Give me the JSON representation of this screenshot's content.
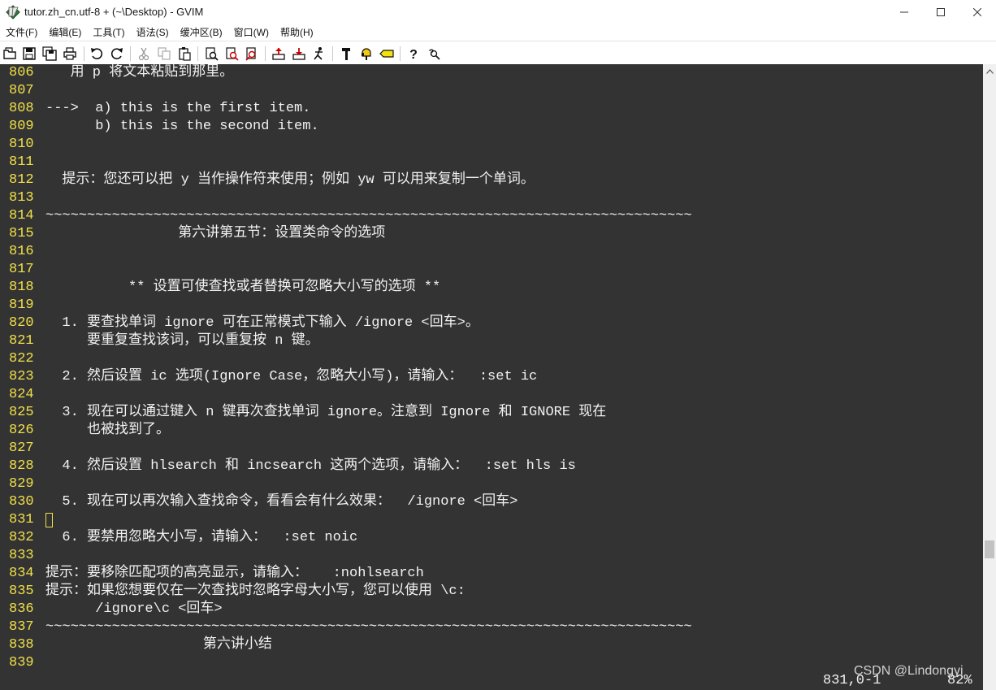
{
  "window": {
    "title": "tutor.zh_cn.utf-8 + (~\\Desktop) - GVIM",
    "icon": "gvim-app-icon",
    "controls": [
      "minimize-icon",
      "maximize-icon",
      "close-icon"
    ]
  },
  "menu": [
    "文件(F)",
    "编辑(E)",
    "工具(T)",
    "语法(S)",
    "缓冲区(B)",
    "窗口(W)",
    "帮助(H)"
  ],
  "toolbar": {
    "buttons": [
      "open-icon",
      "save-icon",
      "save-all-icon",
      "print-icon",
      "undo-icon",
      "redo-icon",
      "cut-icon",
      "copy-icon",
      "paste-icon",
      "find-replace-icon",
      "find-next-icon",
      "find-prev-icon",
      "load-session-icon",
      "save-session-icon",
      "run-script-icon",
      "make-icon",
      "build-tags-icon",
      "jump-tag-icon",
      "help-icon",
      "find-help-icon"
    ]
  },
  "editor": {
    "lines": [
      {
        "num": "806",
        "text": "   用 p 将文本粘贴到那里。"
      },
      {
        "num": "807",
        "text": ""
      },
      {
        "num": "808",
        "text": "--->  a) this is the first item."
      },
      {
        "num": "809",
        "text": "      b) this is the second item."
      },
      {
        "num": "810",
        "text": ""
      },
      {
        "num": "811",
        "text": ""
      },
      {
        "num": "812",
        "text": "  提示：您还可以把 y 当作操作符来使用；例如 yw 可以用来复制一个单词。"
      },
      {
        "num": "813",
        "text": ""
      },
      {
        "num": "814",
        "text": "~~~~~~~~~~~~~~~~~~~~~~~~~~~~~~~~~~~~~~~~~~~~~~~~~~~~~~~~~~~~~~~~~~~~~~~~~~~~~~"
      },
      {
        "num": "815",
        "text": "                第六讲第五节：设置类命令的选项"
      },
      {
        "num": "816",
        "text": ""
      },
      {
        "num": "817",
        "text": ""
      },
      {
        "num": "818",
        "text": "          ** 设置可使查找或者替换可忽略大小写的选项 **"
      },
      {
        "num": "819",
        "text": ""
      },
      {
        "num": "820",
        "text": "  1. 要查找单词 ignore 可在正常模式下输入 /ignore <回车>。"
      },
      {
        "num": "821",
        "text": "     要重复查找该词，可以重复按 n 键。"
      },
      {
        "num": "822",
        "text": ""
      },
      {
        "num": "823",
        "text": "  2. 然后设置 ic 选项(Ignore Case，忽略大小写)，请输入：  :set ic"
      },
      {
        "num": "824",
        "text": ""
      },
      {
        "num": "825",
        "text": "  3. 现在可以通过键入 n 键再次查找单词 ignore。注意到 Ignore 和 IGNORE 现在"
      },
      {
        "num": "826",
        "text": "     也被找到了。"
      },
      {
        "num": "827",
        "text": ""
      },
      {
        "num": "828",
        "text": "  4. 然后设置 hlsearch 和 incsearch 这两个选项，请输入：  :set hls is"
      },
      {
        "num": "829",
        "text": ""
      },
      {
        "num": "830",
        "text": "  5. 现在可以再次输入查找命令，看看会有什么效果：  /ignore <回车>"
      },
      {
        "num": "831",
        "text": ""
      },
      {
        "num": "832",
        "text": "  6. 要禁用忽略大小写，请输入：  :set noic"
      },
      {
        "num": "833",
        "text": ""
      },
      {
        "num": "834",
        "text": "提示：要移除匹配项的高亮显示，请输入：   :nohlsearch"
      },
      {
        "num": "835",
        "text": "提示：如果您想要仅在一次查找时忽略字母大小写，您可以使用 \\c:"
      },
      {
        "num": "836",
        "text": "      /ignore\\c <回车>"
      },
      {
        "num": "837",
        "text": "~~~~~~~~~~~~~~~~~~~~~~~~~~~~~~~~~~~~~~~~~~~~~~~~~~~~~~~~~~~~~~~~~~~~~~~~~~~~~~"
      },
      {
        "num": "838",
        "text": "                   第六讲小结"
      },
      {
        "num": "839",
        "text": ""
      }
    ],
    "cursor_line": "831",
    "ruler": "831,0-1",
    "percent": "82%",
    "scroll_position": 0.82
  },
  "watermark": "CSDN @Lindongyi",
  "colors": {
    "editor_bg": "#333333",
    "line_number": "#f0e04a",
    "text": "#f2f2f2"
  }
}
